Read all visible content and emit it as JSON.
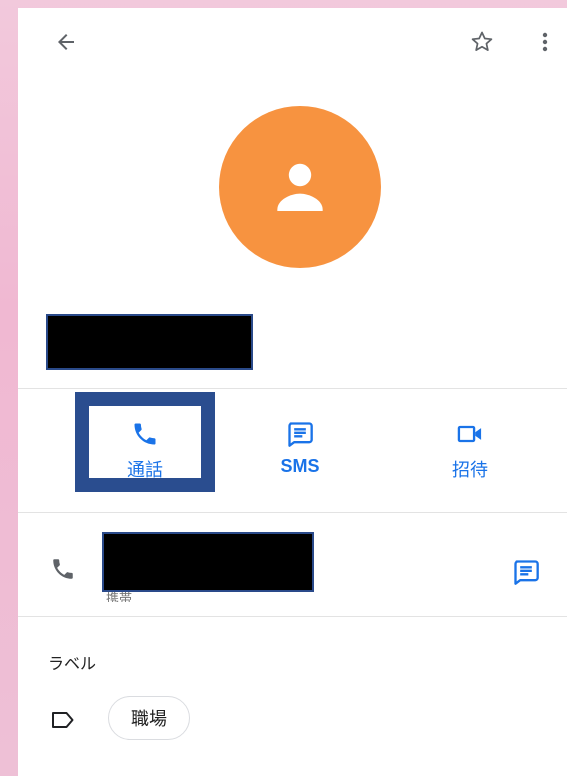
{
  "topbar": {
    "back_icon": "arrow-back-icon",
    "star_icon": "star-outline-icon",
    "more_icon": "more-vert-icon"
  },
  "avatar": {
    "icon": "person-icon",
    "color": "#f79340"
  },
  "actions": [
    {
      "label": "通話",
      "icon": "phone-icon"
    },
    {
      "label": "SMS",
      "icon": "message-icon"
    },
    {
      "label": "招待",
      "icon": "videocam-icon"
    }
  ],
  "phone": {
    "type_label": "携帯",
    "icon": "phone-icon",
    "message_icon": "message-icon"
  },
  "labels": {
    "section_title": "ラベル",
    "icon": "label-outline-icon",
    "chips": [
      "職場"
    ]
  },
  "colors": {
    "accent": "#1a73e8",
    "highlight_border": "#2a4d8f"
  }
}
